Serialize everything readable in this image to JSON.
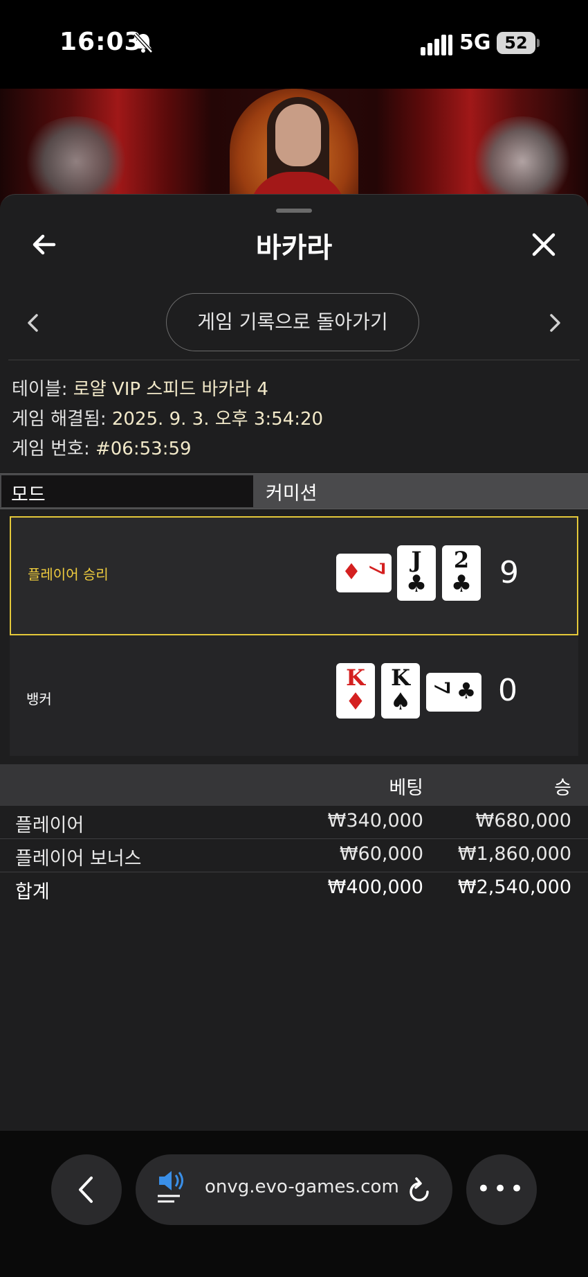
{
  "status_bar": {
    "time": "16:03",
    "network": "5G",
    "battery": "52"
  },
  "header": {
    "title": "바카라"
  },
  "history_button": {
    "label": "게임 기록으로 돌아가기"
  },
  "game_info": {
    "table_label": "테이블: ",
    "table_value": "로얄 VIP 스피드 바카라 4",
    "resolved_label": "게임 해결됨: ",
    "resolved_value": "2025. 9. 3. 오후 3:54:20",
    "number_label": "게임 번호: ",
    "number_value": "#06:53:59"
  },
  "mode": {
    "label": "모드",
    "value": "커미션"
  },
  "results": {
    "player": {
      "label": "플레이어 승리",
      "score": "9",
      "cards": [
        {
          "rank": "7",
          "suit": "♦",
          "color": "#d42020",
          "orientation": "sideways"
        },
        {
          "rank": "J",
          "suit": "♣",
          "color": "#111111",
          "orientation": "upright"
        },
        {
          "rank": "2",
          "suit": "♣",
          "color": "#111111",
          "orientation": "upright"
        }
      ]
    },
    "banker": {
      "label": "뱅커",
      "score": "0",
      "cards": [
        {
          "rank": "K",
          "suit": "♦",
          "color": "#d42020",
          "orientation": "upright"
        },
        {
          "rank": "K",
          "suit": "♠",
          "color": "#111111",
          "orientation": "upright"
        },
        {
          "rank": "7",
          "suit": "♣",
          "color": "#111111",
          "orientation": "sideways"
        }
      ]
    }
  },
  "bets": {
    "headers": {
      "bet": "베팅",
      "win": "승"
    },
    "rows": [
      {
        "name": "플레이어",
        "bet": "₩340,000",
        "win": "₩680,000"
      },
      {
        "name": "플레이어 보너스",
        "bet": "₩60,000",
        "win": "₩1,860,000"
      }
    ],
    "total": {
      "name": "합계",
      "bet": "₩400,000",
      "win": "₩2,540,000"
    }
  },
  "browser": {
    "url": "onvg.evo-games.com"
  },
  "colors": {
    "accent_yellow": "#e4c83a",
    "card_red": "#d42020",
    "sheet_bg": "#1e1e1f"
  }
}
